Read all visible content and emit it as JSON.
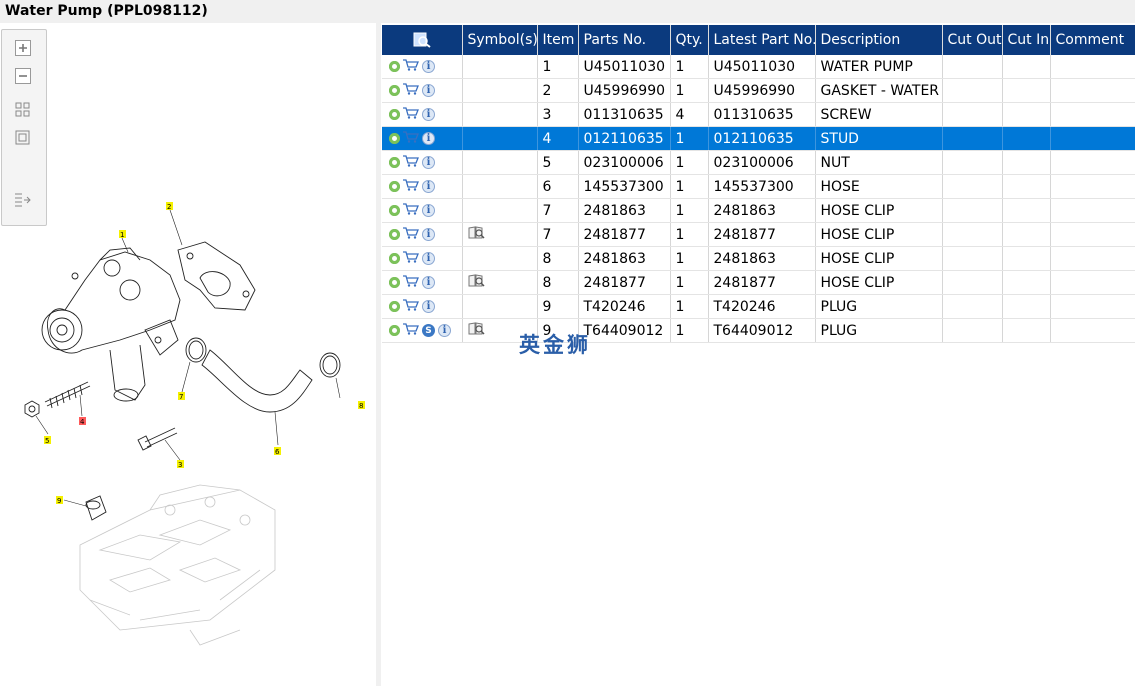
{
  "window": {
    "title": "Water Pump (PPL098112)"
  },
  "toolbar": {
    "buttons": [
      {
        "name": "zoom-in-icon"
      },
      {
        "name": "zoom-out-icon"
      },
      {
        "name": "fit-all-icon"
      },
      {
        "name": "fit-page-icon"
      },
      {
        "name": "toggle-panel-icon"
      }
    ]
  },
  "diagram": {
    "callouts": [
      "1",
      "2",
      "3",
      "4",
      "5",
      "6",
      "7",
      "8",
      "9"
    ]
  },
  "table": {
    "columns": [
      "",
      "Symbol(s)",
      "Item",
      "Parts No.",
      "Qty.",
      "Latest Part No.",
      "Description",
      "Cut Out",
      "Cut In",
      "Comment"
    ],
    "rows": [
      {
        "item": "1",
        "part_no": "U45011030",
        "qty": "1",
        "latest": "U45011030",
        "desc": "WATER PUMP",
        "symbol": false,
        "s_badge": false,
        "selected": false
      },
      {
        "item": "2",
        "part_no": "U45996990",
        "qty": "1",
        "latest": "U45996990",
        "desc": "GASKET - WATER PUMP",
        "symbol": false,
        "s_badge": false,
        "selected": false
      },
      {
        "item": "3",
        "part_no": "011310635",
        "qty": "4",
        "latest": "011310635",
        "desc": "SCREW",
        "symbol": false,
        "s_badge": false,
        "selected": false
      },
      {
        "item": "4",
        "part_no": "012110635",
        "qty": "1",
        "latest": "012110635",
        "desc": "STUD",
        "symbol": false,
        "s_badge": false,
        "selected": true
      },
      {
        "item": "5",
        "part_no": "023100006",
        "qty": "1",
        "latest": "023100006",
        "desc": "NUT",
        "symbol": false,
        "s_badge": false,
        "selected": false
      },
      {
        "item": "6",
        "part_no": "145537300",
        "qty": "1",
        "latest": "145537300",
        "desc": "HOSE",
        "symbol": false,
        "s_badge": false,
        "selected": false
      },
      {
        "item": "7",
        "part_no": "2481863",
        "qty": "1",
        "latest": "2481863",
        "desc": "HOSE CLIP",
        "symbol": false,
        "s_badge": false,
        "selected": false
      },
      {
        "item": "7",
        "part_no": "2481877",
        "qty": "1",
        "latest": "2481877",
        "desc": "HOSE CLIP",
        "symbol": true,
        "s_badge": false,
        "selected": false
      },
      {
        "item": "8",
        "part_no": "2481863",
        "qty": "1",
        "latest": "2481863",
        "desc": "HOSE CLIP",
        "symbol": false,
        "s_badge": false,
        "selected": false
      },
      {
        "item": "8",
        "part_no": "2481877",
        "qty": "1",
        "latest": "2481877",
        "desc": "HOSE CLIP",
        "symbol": true,
        "s_badge": false,
        "selected": false
      },
      {
        "item": "9",
        "part_no": "T420246",
        "qty": "1",
        "latest": "T420246",
        "desc": "PLUG",
        "symbol": false,
        "s_badge": false,
        "selected": false
      },
      {
        "item": "9",
        "part_no": "T64409012",
        "qty": "1",
        "latest": "T64409012",
        "desc": "PLUG",
        "symbol": true,
        "s_badge": true,
        "selected": false
      }
    ]
  },
  "watermark": "英金狮",
  "colors": {
    "header": "#0b3a7e",
    "selected_row": "#0078d7",
    "callout": "#f5f100"
  }
}
